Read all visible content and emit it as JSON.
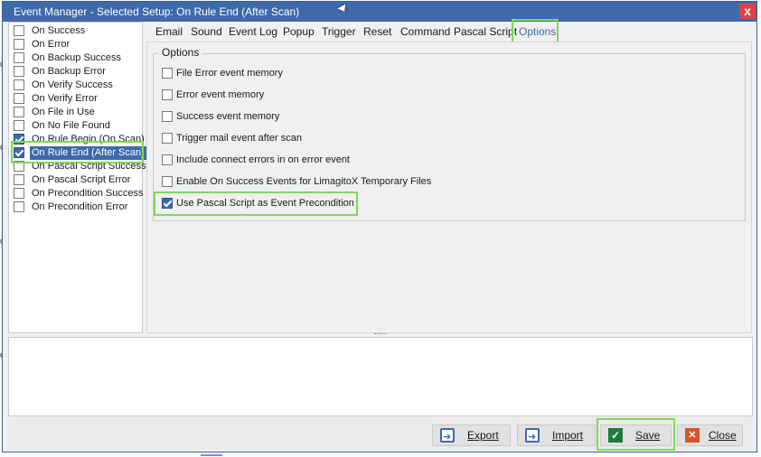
{
  "window": {
    "title": "Event Manager - Selected Setup: On Rule End (After Scan)",
    "close_glyph": "x"
  },
  "events": [
    {
      "label": "On Success",
      "checked": false
    },
    {
      "label": "On Error",
      "checked": false
    },
    {
      "label": "On Backup Success",
      "checked": false
    },
    {
      "label": "On Backup Error",
      "checked": false
    },
    {
      "label": "On Verify Success",
      "checked": false
    },
    {
      "label": "On Verify Error",
      "checked": false
    },
    {
      "label": "On File in Use",
      "checked": false
    },
    {
      "label": "On No File Found",
      "checked": false
    },
    {
      "label": "On Rule Begin (On Scan)",
      "checked": true
    },
    {
      "label": "On Rule End (After Scan)",
      "checked": true,
      "selected": true
    },
    {
      "label": "On Pascal Script Success",
      "checked": false
    },
    {
      "label": "On Pascal Script Error",
      "checked": false
    },
    {
      "label": "On Precondition Success",
      "checked": false
    },
    {
      "label": "On Precondition Error",
      "checked": false
    }
  ],
  "tabs": [
    "Email",
    "Sound",
    "Event Log",
    "Popup",
    "Trigger",
    "Reset",
    "Command",
    "Pascal Script",
    "Options"
  ],
  "active_tab": "Options",
  "options_group": {
    "legend": "Options",
    "items": [
      {
        "label": "File Error event memory",
        "checked": false
      },
      {
        "label": "Error event memory",
        "checked": false
      },
      {
        "label": "Success event memory",
        "checked": false
      },
      {
        "label": "Trigger mail event after scan",
        "checked": false
      },
      {
        "label": "Include connect errors in on error event",
        "checked": false
      },
      {
        "label": "Enable On Success Events for LimagitoX Temporary Files",
        "checked": false
      },
      {
        "label": "Use Pascal Script as Event Precondition",
        "checked": true
      }
    ]
  },
  "buttons": {
    "export": "Export",
    "import": "Import",
    "save": "Save",
    "close": "Close"
  },
  "background_fragments": [
    "o",
    "o",
    "o",
    "er"
  ],
  "colors": {
    "accent": "#3e6aab",
    "highlight": "#7ed957",
    "close_red": "#e04343"
  }
}
